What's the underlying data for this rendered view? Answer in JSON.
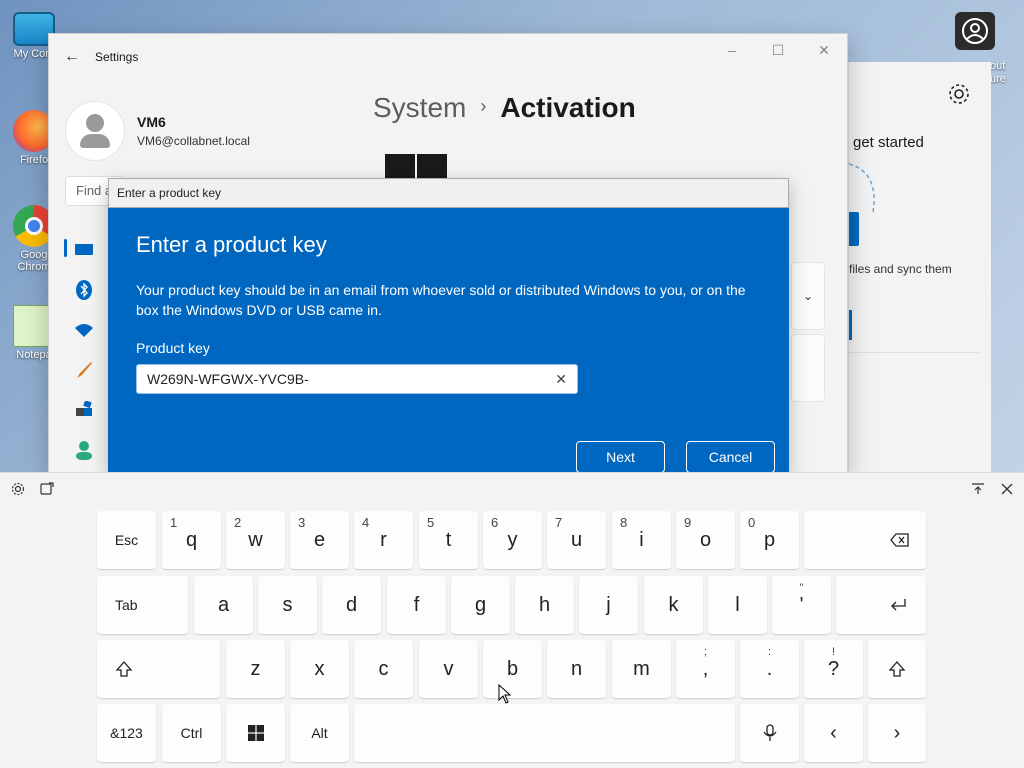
{
  "desktop": {
    "icons": [
      {
        "label": "My Com"
      },
      {
        "label": "Firefo"
      },
      {
        "label": "Goog Chrom"
      },
      {
        "label": "Notepa"
      }
    ],
    "right_partial": "out\nure"
  },
  "settings": {
    "title": "Settings",
    "user": {
      "name": "VM6",
      "email": "VM6@collabnet.local"
    },
    "find_placeholder": "Find a",
    "breadcrumb": {
      "parent": "System",
      "separator": "›",
      "current": "Activation"
    }
  },
  "right_window": {
    "title": "get started",
    "desc": "files and sync them"
  },
  "dialog": {
    "titlebar": "Enter a product key",
    "heading": "Enter a product key",
    "description": "Your product key should be in an email from whoever sold or distributed Windows to you, or on the box the Windows DVD or USB came in.",
    "field_label": "Product key",
    "field_value": "W269N-WFGWX-YVC9B-",
    "clear_icon": "✕",
    "next_label": "Next",
    "cancel_label": "Cancel"
  },
  "keyboard": {
    "row1": [
      {
        "label": "Esc"
      },
      {
        "label": "q",
        "hint": "1"
      },
      {
        "label": "w",
        "hint": "2"
      },
      {
        "label": "e",
        "hint": "3"
      },
      {
        "label": "r",
        "hint": "4"
      },
      {
        "label": "t",
        "hint": "5"
      },
      {
        "label": "y",
        "hint": "6"
      },
      {
        "label": "u",
        "hint": "7"
      },
      {
        "label": "i",
        "hint": "8"
      },
      {
        "label": "o",
        "hint": "9"
      },
      {
        "label": "p",
        "hint": "0"
      }
    ],
    "row2": [
      {
        "label": "Tab"
      },
      {
        "label": "a"
      },
      {
        "label": "s"
      },
      {
        "label": "d"
      },
      {
        "label": "f"
      },
      {
        "label": "g"
      },
      {
        "label": "h"
      },
      {
        "label": "j"
      },
      {
        "label": "k"
      },
      {
        "label": "l"
      },
      {
        "label": "'",
        "top": "\""
      }
    ],
    "row3": [
      {
        "label": "z"
      },
      {
        "label": "x"
      },
      {
        "label": "c"
      },
      {
        "label": "v"
      },
      {
        "label": "b"
      },
      {
        "label": "n"
      },
      {
        "label": "m"
      },
      {
        "label": ",",
        "top": ";"
      },
      {
        "label": ".",
        "top": ":"
      },
      {
        "label": "?",
        "top": "!"
      }
    ],
    "row4": {
      "sym": "&123",
      "ctrl": "Ctrl",
      "alt": "Alt",
      "left": "‹",
      "right": "›"
    }
  }
}
